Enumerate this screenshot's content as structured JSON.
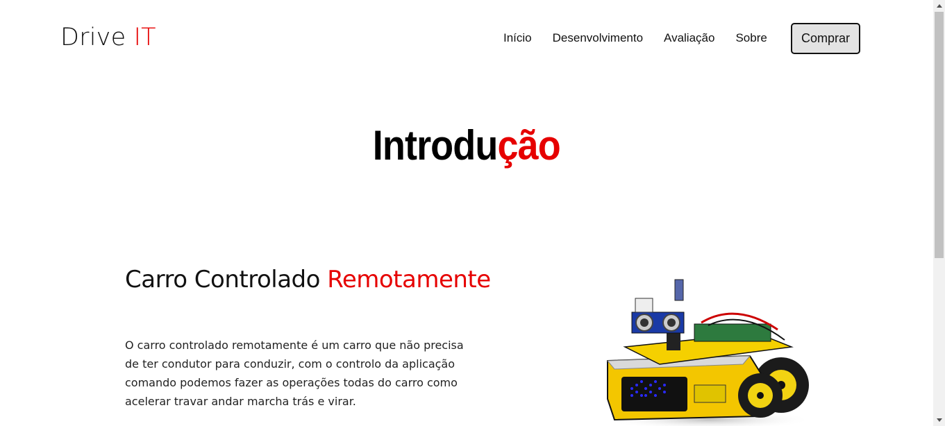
{
  "brand": {
    "name": "Drive",
    "accent": "IT"
  },
  "nav": {
    "items": [
      "Início",
      "Desenvolvimento",
      "Avaliação",
      "Sobre"
    ],
    "cta": "Comprar"
  },
  "hero": {
    "title_main": "Introdu",
    "title_accent": "ção"
  },
  "section": {
    "heading_main": "Carro Controlado",
    "heading_accent": "Remotamente",
    "text": "O carro controlado remotamente é um carro que não precisa de ter condutor para conduzir, com o controlo da aplicação comando podemos fazer as operações todas do carro como acelerar travar andar marcha trás e virar."
  },
  "colors": {
    "accent": "#e60000",
    "button_bg": "#e3e3e3"
  },
  "icons": {
    "car_image": "robot-car-image"
  }
}
